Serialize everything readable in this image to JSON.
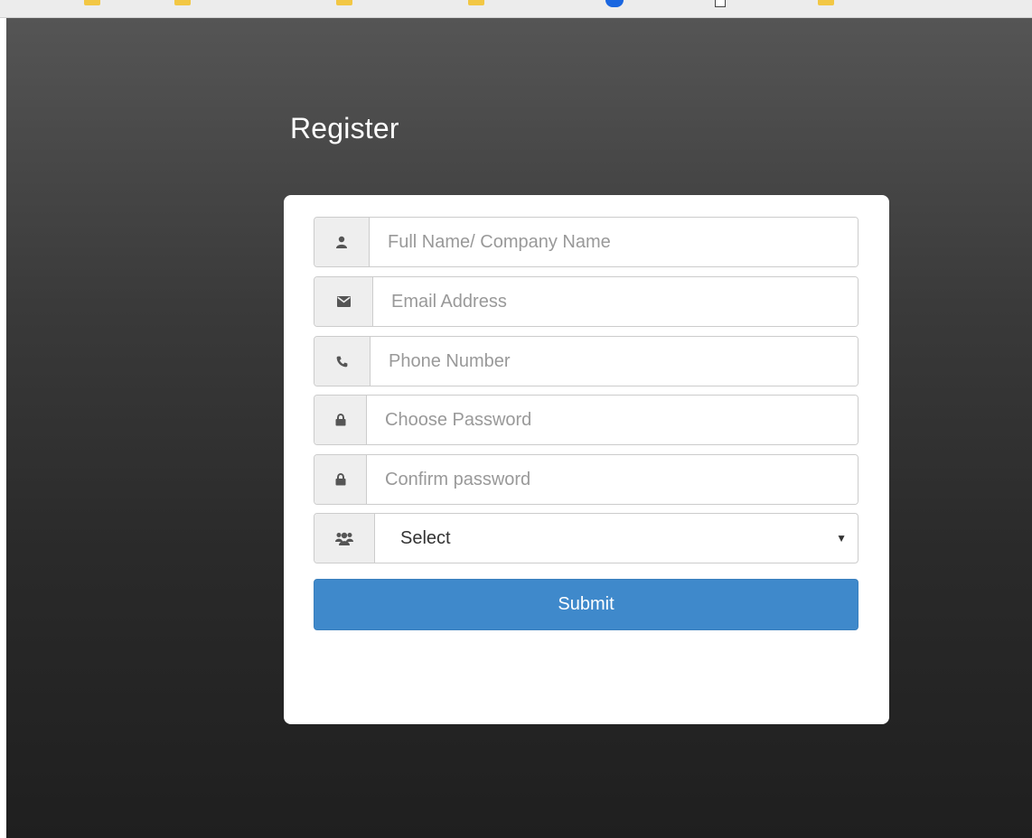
{
  "page": {
    "title": "Register"
  },
  "form": {
    "fields": [
      {
        "name": "full-name",
        "icon": "user-icon",
        "placeholder": "Full Name/ Company Name",
        "value": ""
      },
      {
        "name": "email",
        "icon": "envelope-icon",
        "placeholder": "Email Address",
        "value": ""
      },
      {
        "name": "phone",
        "icon": "phone-icon",
        "placeholder": "Phone Number",
        "value": ""
      },
      {
        "name": "password",
        "icon": "lock-icon",
        "placeholder": "Choose Password",
        "value": ""
      },
      {
        "name": "confirm-password",
        "icon": "lock-icon",
        "placeholder": "Confirm password",
        "value": ""
      }
    ],
    "group_select": {
      "icon": "users-icon",
      "selected": "Select",
      "caret": "▼"
    },
    "submit_label": "Submit"
  },
  "colors": {
    "accent": "#3f89cb",
    "background_top": "#555555",
    "background_bottom": "#1f1f1f",
    "card": "#ffffff",
    "addon": "#eeeeee",
    "icon": "#555555",
    "placeholder": "#999999"
  }
}
